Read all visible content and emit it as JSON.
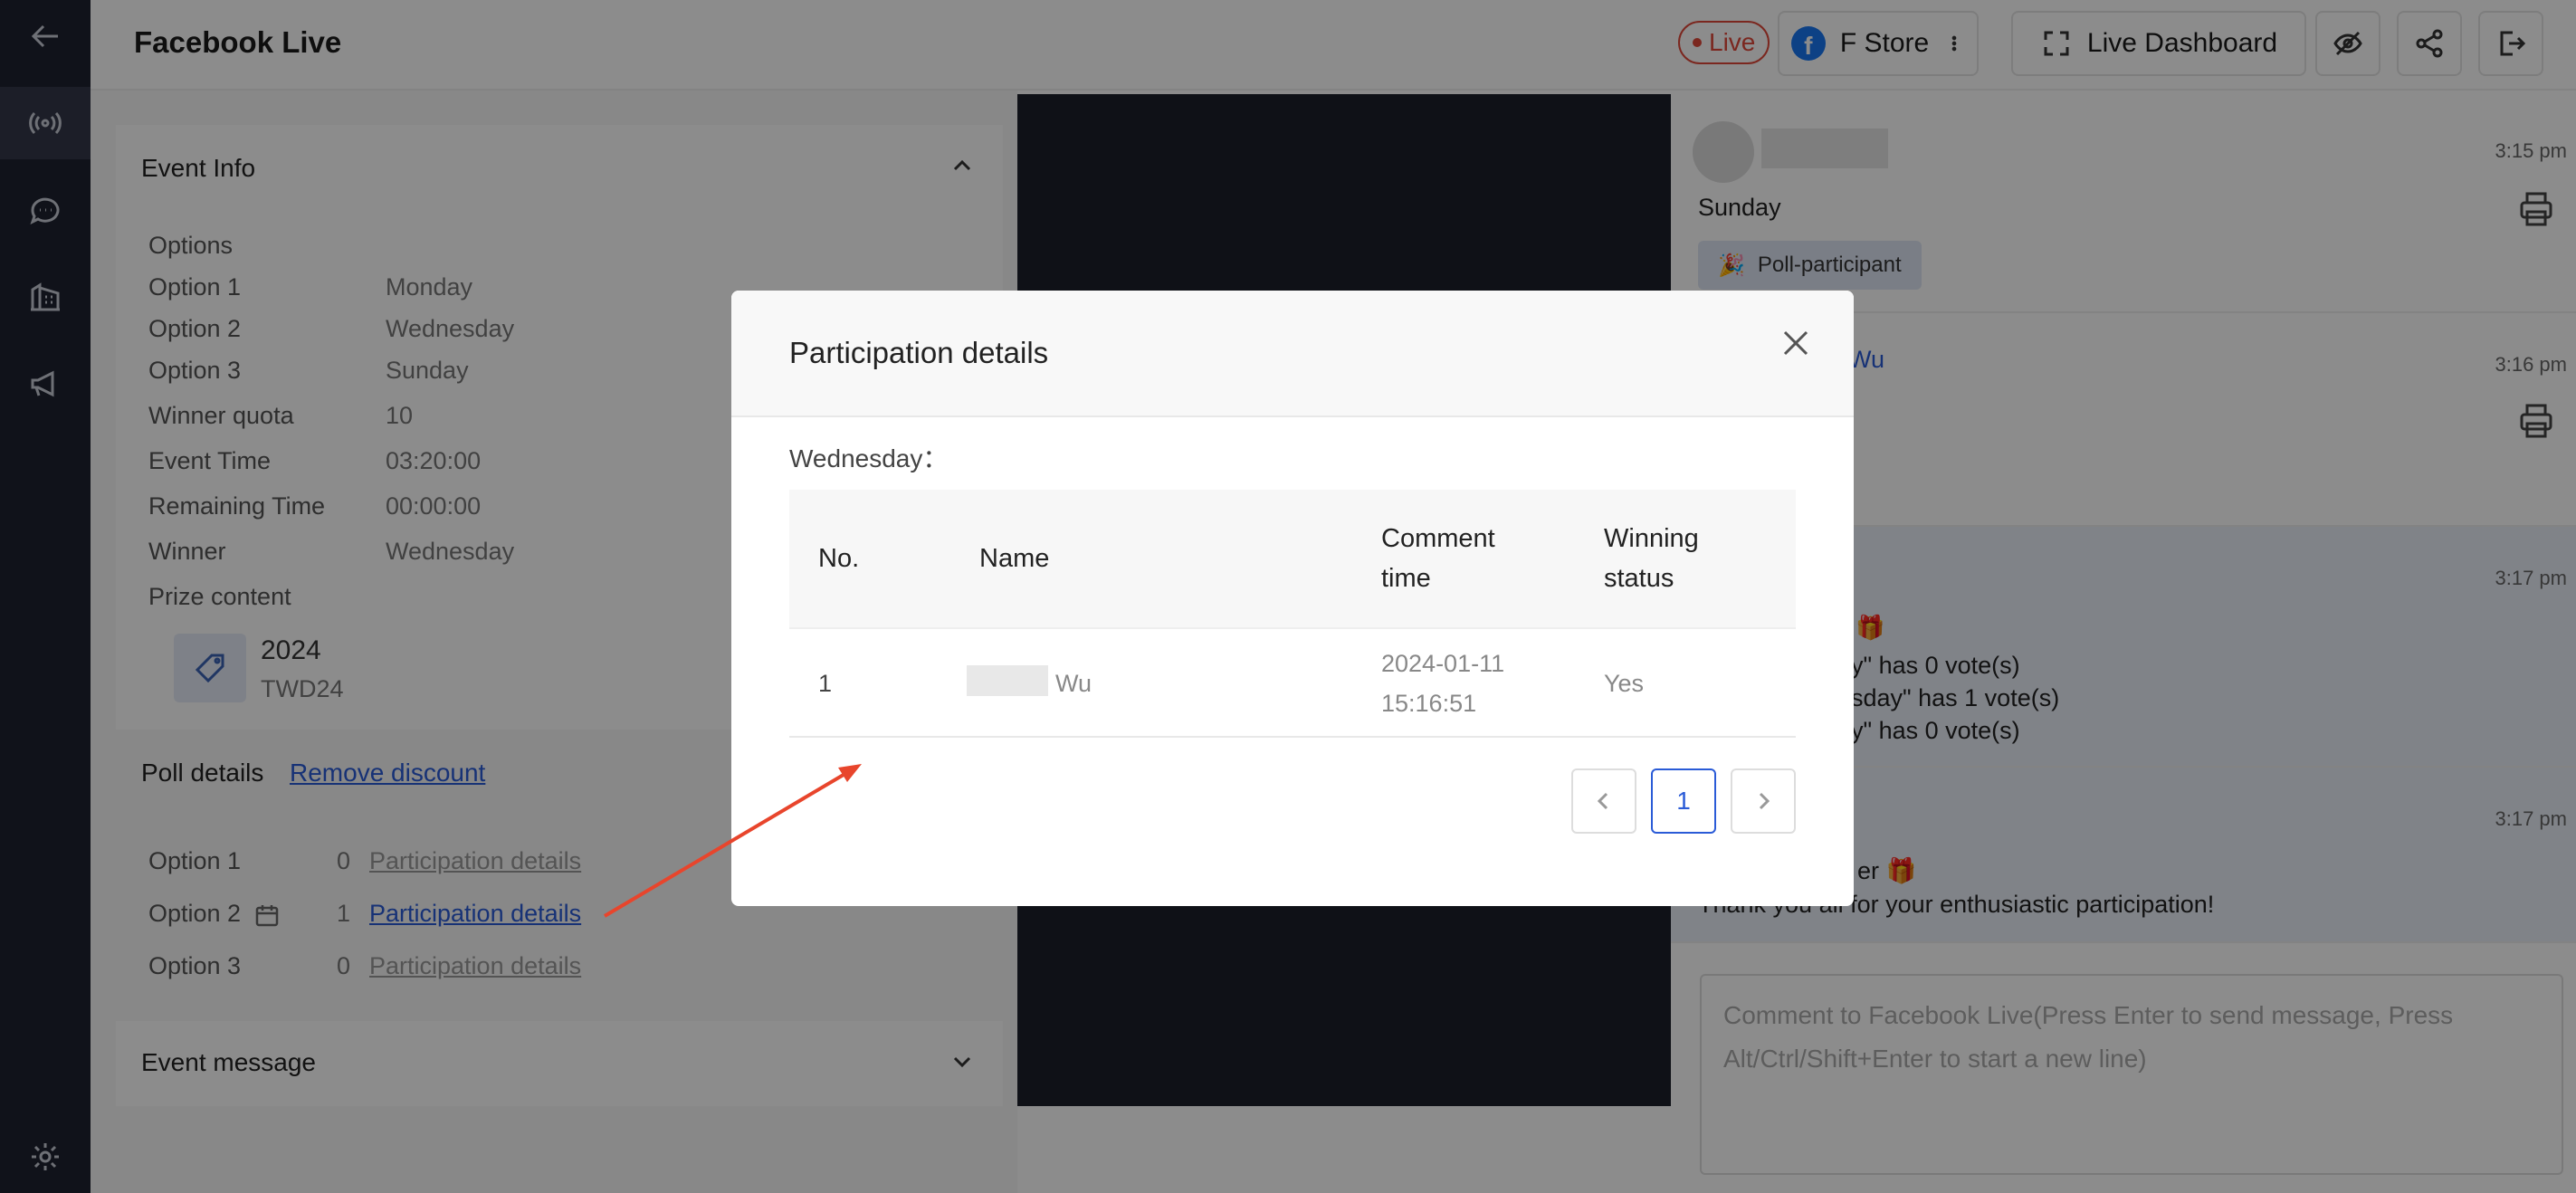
{
  "header": {
    "title": "Facebook Live",
    "live_label": "Live",
    "store_name": "F Store",
    "dashboard_label": "Live Dashboard"
  },
  "event_info": {
    "title": "Event Info",
    "options_heading": "Options",
    "options": [
      {
        "label": "Option 1",
        "value": "Monday"
      },
      {
        "label": "Option 2",
        "value": "Wednesday"
      },
      {
        "label": "Option 3",
        "value": "Sunday"
      }
    ],
    "fields": [
      {
        "label": "Winner quota",
        "value": "10"
      },
      {
        "label": "Event Time",
        "value": "03:20:00"
      },
      {
        "label": "Remaining Time",
        "value": "00:00:00"
      },
      {
        "label": "Winner",
        "value": "Wednesday"
      }
    ],
    "prize_heading": "Prize content",
    "prize_name": "2024",
    "prize_code": "TWD24"
  },
  "poll_details": {
    "title": "Poll details",
    "remove_discount": "Remove discount",
    "rows": [
      {
        "label": "Option 1",
        "count": "0",
        "link": "Participation details"
      },
      {
        "label": "Option 2",
        "count": "1",
        "link": "Participation details"
      },
      {
        "label": "Option 3",
        "count": "0",
        "link": "Participation details"
      }
    ]
  },
  "event_message": {
    "title": "Event message"
  },
  "chat": {
    "messages": [
      {
        "time": "3:15 pm",
        "text": "Sunday",
        "chip": "Poll-participant"
      },
      {
        "time": "3:16 pm",
        "name_fragment": "Wu",
        "chip_fragment": "er"
      },
      {
        "time": "3:17 pm",
        "lines": [
          "ay\" has 0 vote(s)",
          "esday\" has 1 vote(s)",
          "ay\" has 0 vote(s)"
        ]
      },
      {
        "time": "3:17 pm",
        "line1": "er",
        "line2": "Thank you all for your enthusiastic participation!"
      }
    ],
    "comment_placeholder": "Comment to Facebook Live(Press Enter to send message, Press Alt/Ctrl/Shift+Enter to start a new line)"
  },
  "modal": {
    "title": "Participation details",
    "option_label": "Wednesday：",
    "columns": {
      "no": "No.",
      "name": "Name",
      "comment_time_1": "Comment",
      "comment_time_2": "time",
      "winning_1": "Winning",
      "winning_2": "status"
    },
    "rows": [
      {
        "no": "1",
        "name": "Wu",
        "date": "2024-01-11",
        "time": "15:16:51",
        "status": "Yes"
      }
    ],
    "current_page": "1"
  },
  "colors": {
    "rail": "#1e2230",
    "accent": "#2a5bd7",
    "live": "#e0483a",
    "annotation_arrow": "#e8452c"
  }
}
